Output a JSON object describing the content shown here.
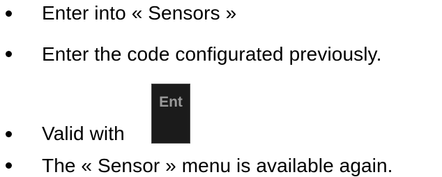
{
  "items": [
    {
      "text": "Enter into « Sensors »"
    },
    {
      "text": "Enter the code configurated previously."
    },
    {
      "text": "Valid with",
      "key_label": "Ent"
    },
    {
      "text": "The « Sensor » menu is available again."
    }
  ]
}
